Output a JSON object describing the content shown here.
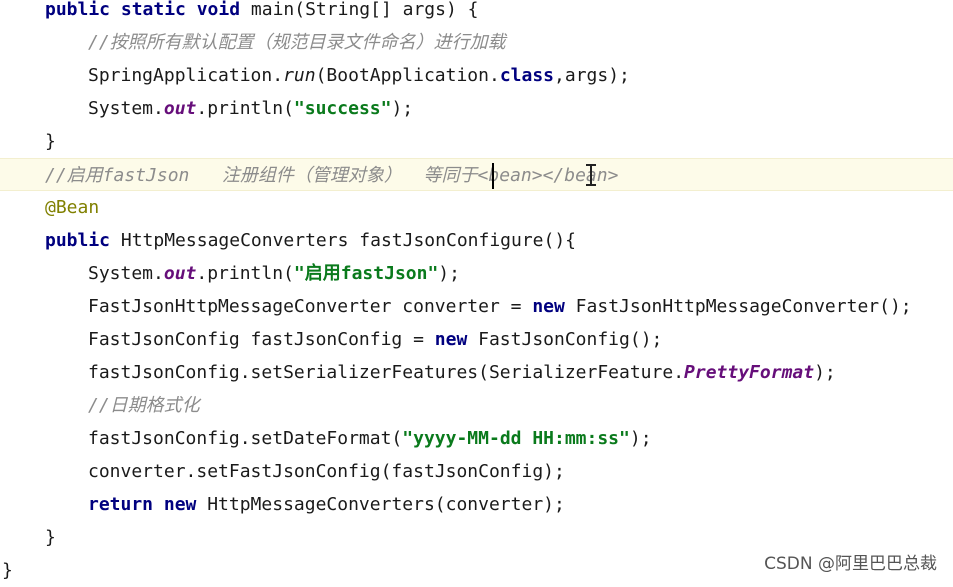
{
  "lines": [
    {
      "indent": 45,
      "tokens": [
        {
          "t": "public static void",
          "c": "kw"
        },
        {
          "t": " main(String[] args) {",
          "c": ""
        }
      ]
    },
    {
      "indent": 88,
      "tokens": [
        {
          "t": "//按照所有默认配置（规范目录文件命名）进行加载",
          "c": "cmt"
        }
      ]
    },
    {
      "indent": 88,
      "tokens": [
        {
          "t": "SpringApplication.",
          "c": ""
        },
        {
          "t": "run",
          "c": "stat"
        },
        {
          "t": "(BootApplication.",
          "c": ""
        },
        {
          "t": "class",
          "c": "kw"
        },
        {
          "t": ",args);",
          "c": ""
        }
      ]
    },
    {
      "indent": 88,
      "tokens": [
        {
          "t": "System.",
          "c": ""
        },
        {
          "t": "out",
          "c": "field"
        },
        {
          "t": ".println(",
          "c": ""
        },
        {
          "t": "\"success\"",
          "c": "str"
        },
        {
          "t": ");",
          "c": ""
        }
      ]
    },
    {
      "indent": 45,
      "tokens": [
        {
          "t": "}",
          "c": ""
        }
      ]
    },
    {
      "indent": 45,
      "highlight": true,
      "tokens": [
        {
          "t": "//启用fastJson   注册组件（管理对象）  等同于<bean></bean>",
          "c": "cmt"
        }
      ]
    },
    {
      "indent": 45,
      "tokens": [
        {
          "t": "@Bean",
          "c": "ann"
        }
      ]
    },
    {
      "indent": 45,
      "tokens": [
        {
          "t": "public",
          "c": "kw"
        },
        {
          "t": " HttpMessageConverters fastJsonConfigure(){",
          "c": ""
        }
      ]
    },
    {
      "indent": 88,
      "tokens": [
        {
          "t": "System.",
          "c": ""
        },
        {
          "t": "out",
          "c": "field"
        },
        {
          "t": ".println(",
          "c": ""
        },
        {
          "t": "\"启用fastJson\"",
          "c": "str"
        },
        {
          "t": ");",
          "c": ""
        }
      ]
    },
    {
      "indent": 88,
      "tokens": [
        {
          "t": "FastJsonHttpMessageConverter converter = ",
          "c": ""
        },
        {
          "t": "new",
          "c": "kw"
        },
        {
          "t": " FastJsonHttpMessageConverter();",
          "c": ""
        }
      ]
    },
    {
      "indent": 88,
      "tokens": [
        {
          "t": "FastJsonConfig fastJsonConfig = ",
          "c": ""
        },
        {
          "t": "new",
          "c": "kw"
        },
        {
          "t": " FastJsonConfig();",
          "c": ""
        }
      ]
    },
    {
      "indent": 88,
      "tokens": [
        {
          "t": "fastJsonConfig.setSerializerFeatures(SerializerFeature.",
          "c": ""
        },
        {
          "t": "PrettyFormat",
          "c": "field"
        },
        {
          "t": ");",
          "c": ""
        }
      ]
    },
    {
      "indent": 88,
      "tokens": [
        {
          "t": "//日期格式化",
          "c": "cmt"
        }
      ]
    },
    {
      "indent": 88,
      "tokens": [
        {
          "t": "fastJsonConfig.setDateFormat(",
          "c": ""
        },
        {
          "t": "\"yyyy-MM-dd HH:mm:ss\"",
          "c": "str"
        },
        {
          "t": ");",
          "c": ""
        }
      ]
    },
    {
      "indent": 88,
      "tokens": [
        {
          "t": "converter.setFastJsonConfig(fastJsonConfig);",
          "c": ""
        }
      ]
    },
    {
      "indent": 88,
      "tokens": [
        {
          "t": "return new",
          "c": "kw"
        },
        {
          "t": " HttpMessageConverters(converter);",
          "c": ""
        }
      ]
    },
    {
      "indent": 45,
      "tokens": [
        {
          "t": "}",
          "c": ""
        }
      ]
    },
    {
      "indent": 2,
      "tokens": [
        {
          "t": "}",
          "c": ""
        }
      ]
    }
  ],
  "watermark": "CSDN @阿里巴巴总裁"
}
